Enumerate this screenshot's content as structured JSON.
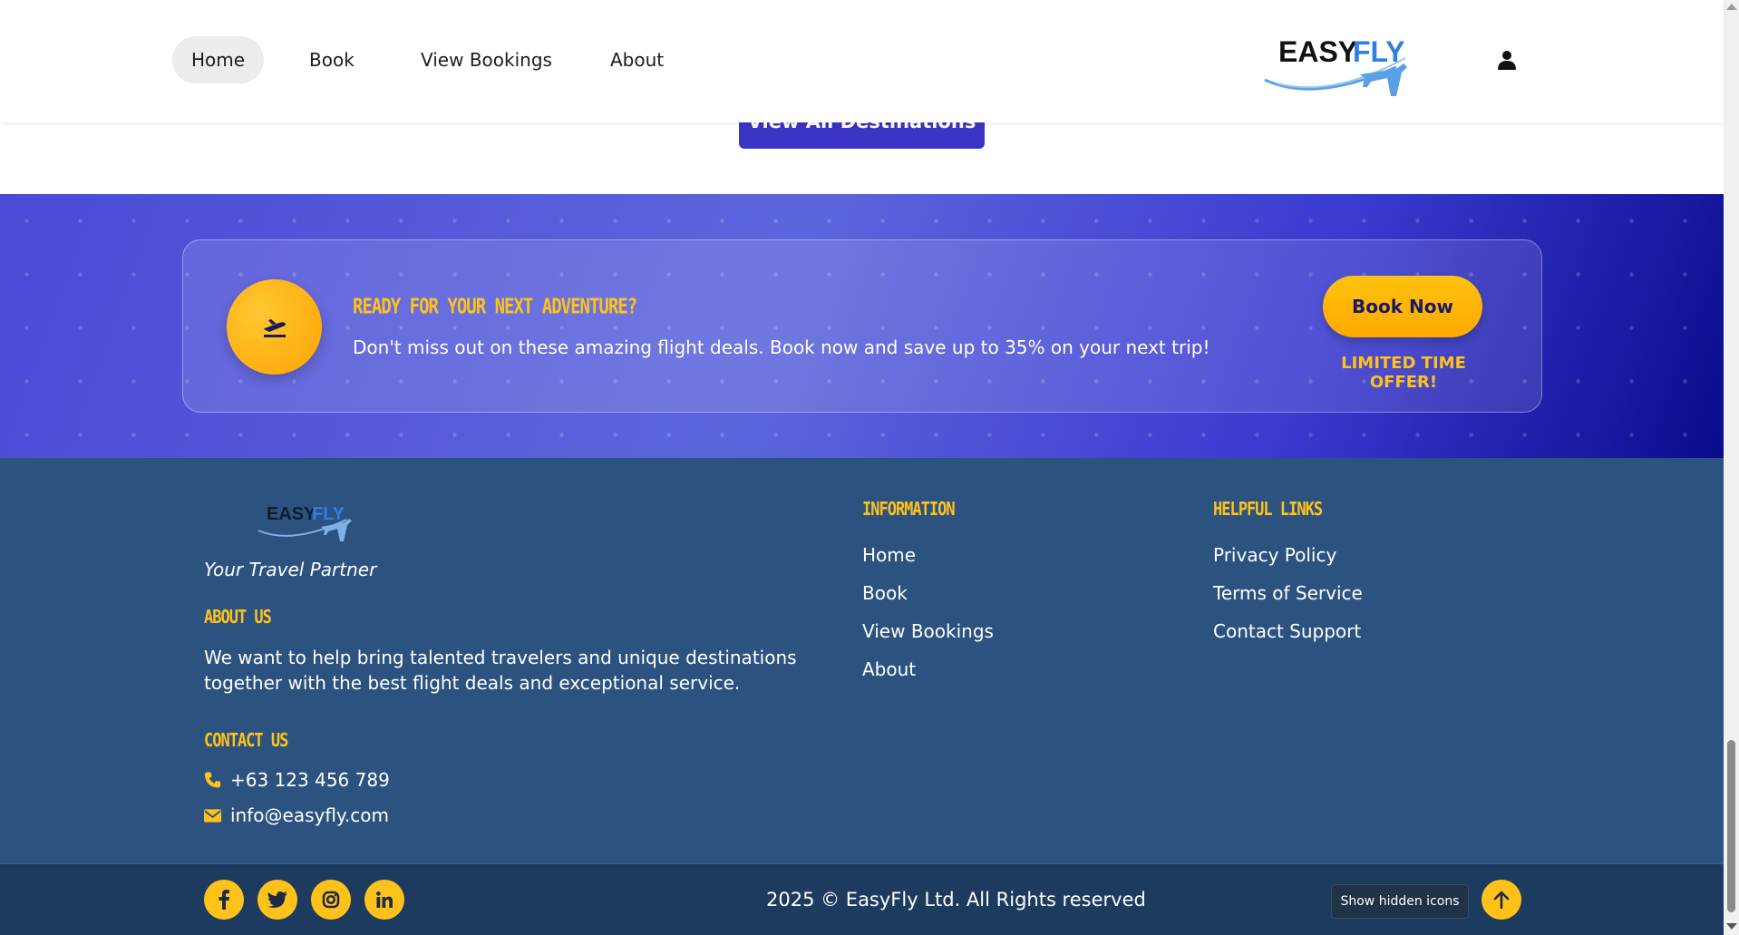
{
  "nav": {
    "links": [
      "Home",
      "Book",
      "View Bookings",
      "About"
    ],
    "active": "Home",
    "logo_text_dark": "EASY",
    "logo_text_blue": "FLY"
  },
  "main": {
    "view_all_label": "View All Destinations"
  },
  "promo": {
    "title": "READY FOR YOUR NEXT ADVENTURE?",
    "text": "Don't miss out on these amazing flight deals. Book now and save up to 35% on your next trip!",
    "book_label": "Book Now",
    "offer": "LIMITED TIME OFFER!"
  },
  "footer": {
    "tagline": "Your Travel Partner",
    "about_heading": "ABOUT US",
    "about_text": "We want to help bring talented travelers and unique destinations together with the best flight deals and exceptional service.",
    "contact_heading": "CONTACT US",
    "phone": "+63 123 456 789",
    "email": "info@easyfly.com",
    "info_heading": "INFORMATION",
    "info_links": [
      "Home",
      "Book",
      "View Bookings",
      "About"
    ],
    "helpful_heading": "HELPFUL LINKS",
    "helpful_links": [
      "Privacy Policy",
      "Terms of Service",
      "Contact Support"
    ]
  },
  "bottom": {
    "copyright": "2025 © EasyFly Ltd. All Rights reserved",
    "tooltip": "Show hidden icons",
    "socials": [
      "facebook-icon",
      "twitter-icon",
      "instagram-icon",
      "linkedin-icon"
    ]
  },
  "colors": {
    "accent_yellow": "#ffc21a",
    "primary_blue": "#3b34c4",
    "footer_bg": "#2c5380",
    "bottom_bar_bg": "#1d3a5f"
  }
}
